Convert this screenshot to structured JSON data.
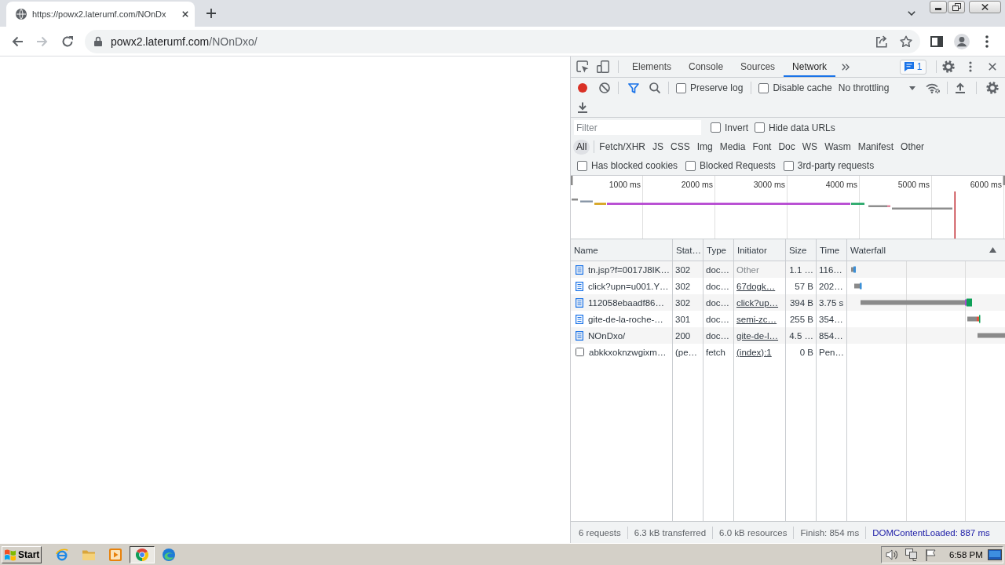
{
  "browser": {
    "tabs": [
      {
        "title": "https://powx2.laterumf.com/NOnDx",
        "selected": true
      }
    ],
    "navigation": {
      "back_disabled": false,
      "forward_disabled": true
    },
    "address": {
      "host": "powx2.laterumf.com",
      "path": "/NOnDxo/"
    }
  },
  "devtools": {
    "panels": [
      {
        "label": "Elements",
        "selected": false
      },
      {
        "label": "Console",
        "selected": false
      },
      {
        "label": "Sources",
        "selected": false
      },
      {
        "label": "Network",
        "selected": true
      }
    ],
    "issues_count": "1",
    "toolbar": {
      "recording": true,
      "filter_active": true,
      "options": [
        {
          "label": "Preserve log",
          "checked": false
        },
        {
          "label": "Disable cache",
          "checked": false
        }
      ],
      "throttling": "No throttling"
    },
    "filter": {
      "placeholder": "Filter",
      "options": [
        {
          "label": "Invert",
          "checked": false
        },
        {
          "label": "Hide data URLs",
          "checked": false
        }
      ]
    },
    "resource_types": [
      {
        "label": "All",
        "selected": true
      },
      {
        "label": "Fetch/XHR",
        "selected": false
      },
      {
        "label": "JS",
        "selected": false
      },
      {
        "label": "CSS",
        "selected": false
      },
      {
        "label": "Img",
        "selected": false
      },
      {
        "label": "Media",
        "selected": false
      },
      {
        "label": "Font",
        "selected": false
      },
      {
        "label": "Doc",
        "selected": false
      },
      {
        "label": "WS",
        "selected": false
      },
      {
        "label": "Wasm",
        "selected": false
      },
      {
        "label": "Manifest",
        "selected": false
      },
      {
        "label": "Other",
        "selected": false
      }
    ],
    "request_filters": [
      {
        "label": "Has blocked cookies",
        "checked": false
      },
      {
        "label": "Blocked Requests",
        "checked": false
      },
      {
        "label": "3rd-party requests",
        "checked": false
      }
    ],
    "overview": {
      "ticks": [
        "1000 ms",
        "2000 ms",
        "3000 ms",
        "4000 ms",
        "5000 ms",
        "6000 ms"
      ]
    },
    "table": {
      "columns": [
        "Name",
        "Stat…",
        "Type",
        "Initiator",
        "Size",
        "Time",
        "Waterfall"
      ],
      "rows": [
        {
          "kind": "document",
          "name": "tn.jsp?f=0017J8IK…",
          "status": "302",
          "type": "doc…",
          "initiator": {
            "text": "Other",
            "link": false
          },
          "size": "1.1 …",
          "time": "116…"
        },
        {
          "kind": "document",
          "name": "click?upn=u001.Y…",
          "status": "302",
          "type": "doc…",
          "initiator": {
            "text": "67dogk…",
            "link": true
          },
          "size": "57 B",
          "time": "202…"
        },
        {
          "kind": "document",
          "name": "112058ebaadf86…",
          "status": "302",
          "type": "doc…",
          "initiator": {
            "text": "click?up…",
            "link": true
          },
          "size": "394 B",
          "time": "3.75 s"
        },
        {
          "kind": "document",
          "name": "gite-de-la-roche-…",
          "status": "301",
          "type": "doc…",
          "initiator": {
            "text": "semi-zc…",
            "link": true
          },
          "size": "255 B",
          "time": "354…"
        },
        {
          "kind": "document",
          "name": "NOnDxo/",
          "status": "200",
          "type": "doc…",
          "initiator": {
            "text": "gite-de-l…",
            "link": true
          },
          "size": "4.5 …",
          "time": "854…"
        },
        {
          "kind": "fetch",
          "name": "abkkxoknzwgixm…",
          "status": "(pe…",
          "type": "fetch",
          "initiator": {
            "text": "(index):1",
            "link": true
          },
          "size": "0 B",
          "time": "Pen…"
        }
      ]
    },
    "summary": {
      "requests": "6 requests",
      "transferred": "6.3 kB transferred",
      "resources": "6.0 kB resources",
      "finish": "Finish: 854 ms",
      "dom_content_loaded": "DOMContentLoaded: 887 ms"
    }
  },
  "taskbar": {
    "start": "Start",
    "apps": [
      {
        "kind": "e_logo",
        "selected": false
      },
      {
        "kind": "folder",
        "selected": false
      },
      {
        "kind": "player",
        "selected": false
      },
      {
        "kind": "ring",
        "selected": true
      },
      {
        "kind": "swirl",
        "selected": false
      }
    ],
    "clock": "6:58 PM"
  }
}
